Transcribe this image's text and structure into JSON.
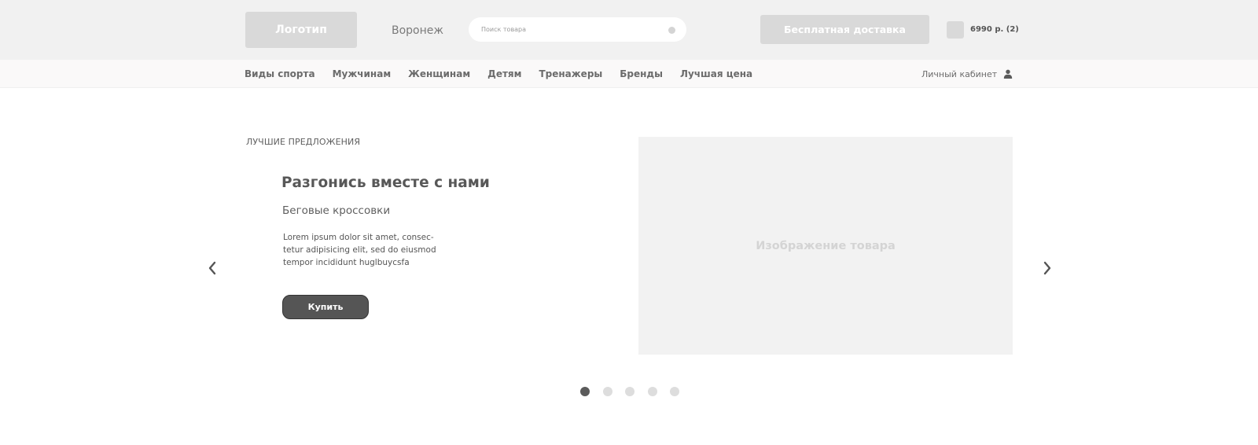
{
  "header": {
    "logo_label": "Логотип",
    "city": "Воронеж",
    "search_placeholder": "Поиск товара",
    "delivery_label": "Бесплатная доставка",
    "cart_summary": "6990 р. (2)"
  },
  "nav": {
    "items": [
      {
        "label": "Виды спорта"
      },
      {
        "label": "Мужчинам"
      },
      {
        "label": "Женщинам"
      },
      {
        "label": "Детям"
      },
      {
        "label": "Тренажеры"
      },
      {
        "label": "Бренды"
      },
      {
        "label": "Лучшая цена"
      }
    ],
    "account_label": "Личный кабинет"
  },
  "promo": {
    "section_label": "ЛУЧШИЕ ПРЕДЛОЖЕНИЯ",
    "title": "Разгонись вместе с нами",
    "subtitle": "Беговые кроссовки",
    "text_lines": [
      "Lorem ipsum dolor sit amet, consec-",
      "tetur adipisicing elit, sed do eiusmod",
      "tempor incididunt huglbuycsfa"
    ],
    "buy_label": "Купить",
    "image_label": "Изображение товара"
  },
  "slider": {
    "total": 5,
    "active_index": 0
  },
  "icons": {
    "prev": "chevron-left-icon",
    "next": "chevron-right-icon",
    "user": "user-icon",
    "cart": "cart-icon"
  },
  "colors": {
    "topbar_bg": "#f1f1f1",
    "placeholder_gray": "#d9d9d9",
    "button_dark": "#555555",
    "image_bg": "#f2f2f2"
  }
}
